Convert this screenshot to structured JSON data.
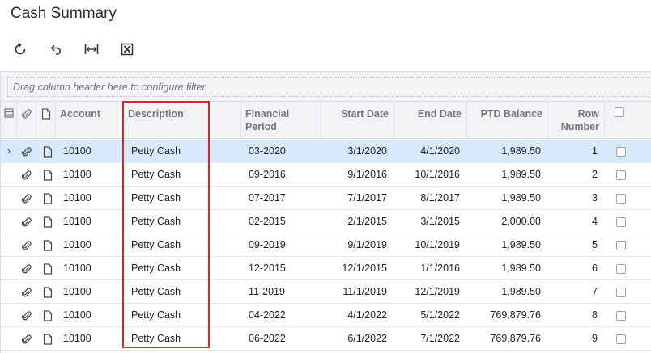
{
  "page": {
    "title": "Cash Summary"
  },
  "toolbar": [
    {
      "name": "refresh-button",
      "icon": "refresh-icon"
    },
    {
      "name": "undo-button",
      "icon": "undo-icon"
    },
    {
      "name": "fit-columns-button",
      "icon": "fit-width-icon"
    },
    {
      "name": "export-excel-button",
      "icon": "excel-icon"
    }
  ],
  "grid": {
    "filter_hint": "Drag column header here to configure filter",
    "columns": {
      "account": "Account",
      "description": "Description",
      "financial_period_line1": "Financial",
      "financial_period_line2": "Period",
      "start_date": "Start Date",
      "end_date": "End Date",
      "ptd_balance": "PTD Balance",
      "row_number_line1": "Row",
      "row_number_line2": "Number"
    },
    "rows": [
      {
        "selected": true,
        "indicator": "›",
        "account": "10100",
        "description": "Petty Cash",
        "financial_period": "03-2020",
        "start_date": "3/1/2020",
        "end_date": "4/1/2020",
        "ptd_balance": "1,989.50",
        "row_number": "1"
      },
      {
        "selected": false,
        "indicator": "",
        "account": "10100",
        "description": "Petty Cash",
        "financial_period": "09-2016",
        "start_date": "9/1/2016",
        "end_date": "10/1/2016",
        "ptd_balance": "1,989.50",
        "row_number": "2"
      },
      {
        "selected": false,
        "indicator": "",
        "account": "10100",
        "description": "Petty Cash",
        "financial_period": "07-2017",
        "start_date": "7/1/2017",
        "end_date": "8/1/2017",
        "ptd_balance": "1,989.50",
        "row_number": "3"
      },
      {
        "selected": false,
        "indicator": "",
        "account": "10100",
        "description": "Petty Cash",
        "financial_period": "02-2015",
        "start_date": "2/1/2015",
        "end_date": "3/1/2015",
        "ptd_balance": "2,000.00",
        "row_number": "4"
      },
      {
        "selected": false,
        "indicator": "",
        "account": "10100",
        "description": "Petty Cash",
        "financial_period": "09-2019",
        "start_date": "9/1/2019",
        "end_date": "10/1/2019",
        "ptd_balance": "1,989.50",
        "row_number": "5"
      },
      {
        "selected": false,
        "indicator": "",
        "account": "10100",
        "description": "Petty Cash",
        "financial_period": "12-2015",
        "start_date": "12/1/2015",
        "end_date": "1/1/2016",
        "ptd_balance": "1,989.50",
        "row_number": "6"
      },
      {
        "selected": false,
        "indicator": "",
        "account": "10100",
        "description": "Petty Cash",
        "financial_period": "11-2019",
        "start_date": "11/1/2019",
        "end_date": "12/1/2019",
        "ptd_balance": "1,989.50",
        "row_number": "7"
      },
      {
        "selected": false,
        "indicator": "",
        "account": "10100",
        "description": "Petty Cash",
        "financial_period": "04-2022",
        "start_date": "4/1/2022",
        "end_date": "5/1/2022",
        "ptd_balance": "769,879.76",
        "row_number": "8"
      },
      {
        "selected": false,
        "indicator": "",
        "account": "10100",
        "description": "Petty Cash",
        "financial_period": "06-2022",
        "start_date": "6/1/2022",
        "end_date": "7/1/2022",
        "ptd_balance": "769,879.76",
        "row_number": "9"
      }
    ]
  },
  "annotation": {
    "highlight_color": "#d6262b",
    "highlighted_column": "Description"
  },
  "colors": {
    "selected_row": "#d8e9fb",
    "header_bg": "#f2f3f5",
    "header_text": "#72767c"
  }
}
